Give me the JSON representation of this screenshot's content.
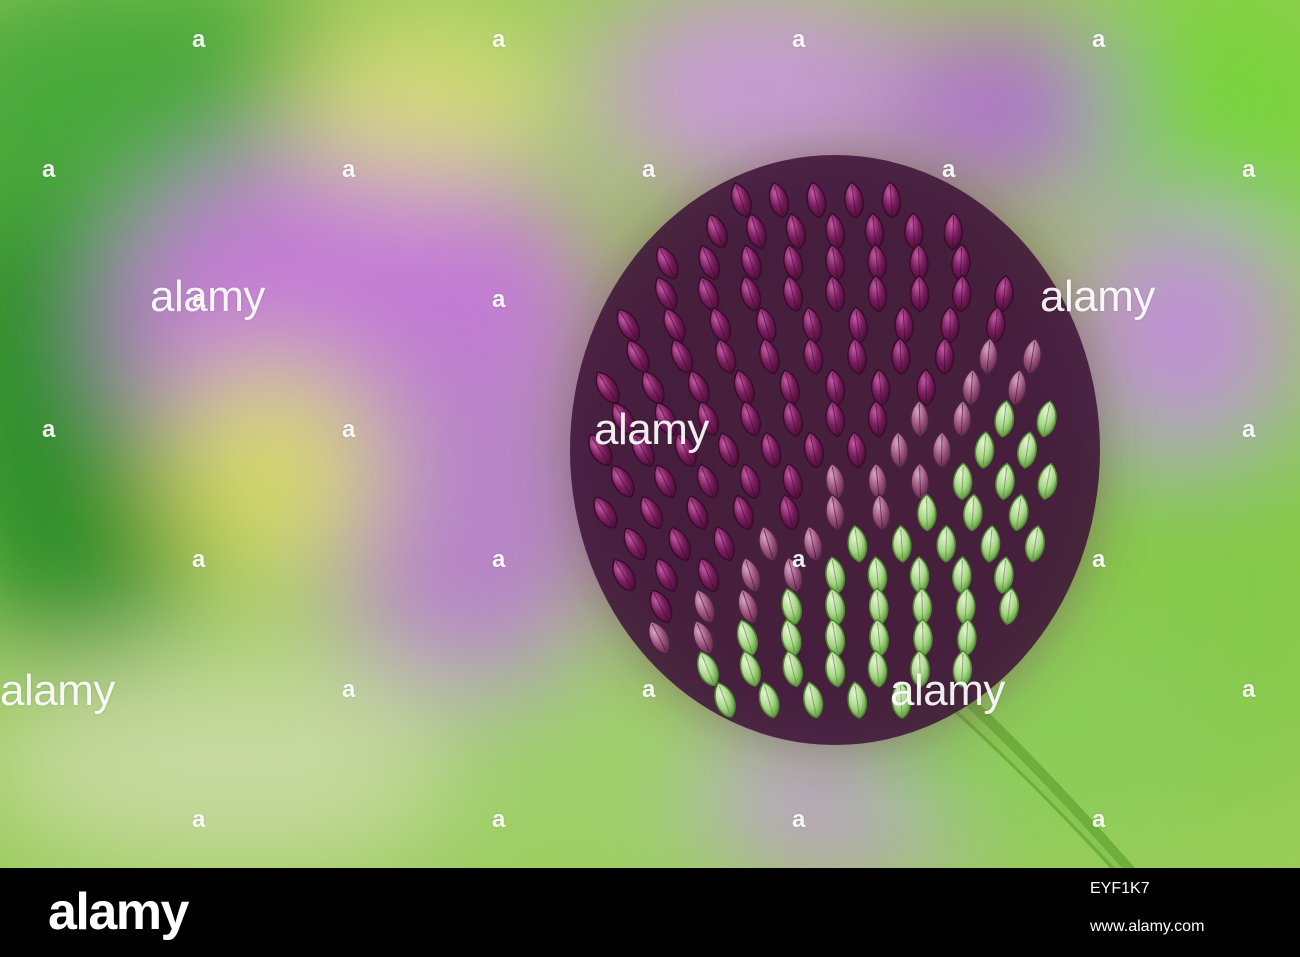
{
  "photo": {
    "subject": "",
    "colors": {
      "background_green": "#8fcf4a",
      "background_purple": "#c47ad6",
      "flower_purple": "#7a1d5e",
      "flower_green": "#9ccf7a",
      "stem": "#6fae3c"
    }
  },
  "watermark": {
    "word": "alamy",
    "letter": "a"
  },
  "footer": {
    "logo": "alamy",
    "image_id": "EYF1K7",
    "url": "www.alamy.com"
  }
}
